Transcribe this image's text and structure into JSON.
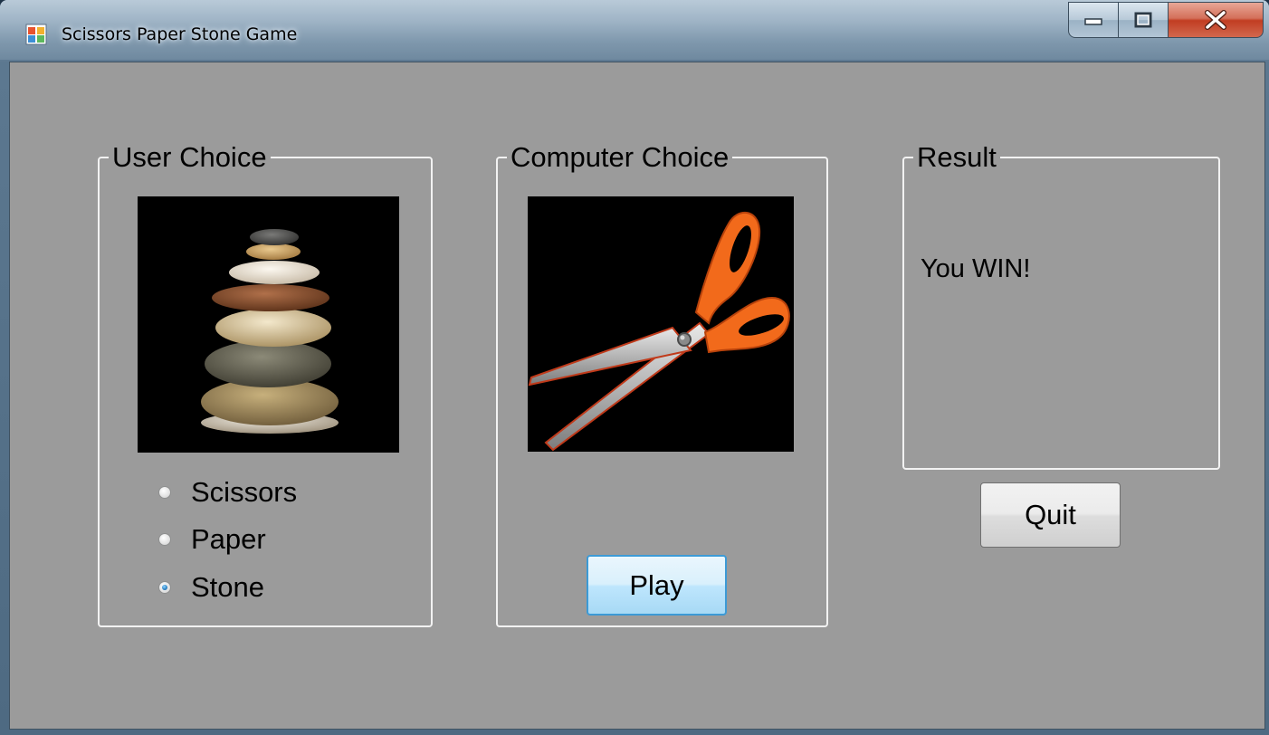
{
  "window": {
    "title": "Scissors Paper Stone Game",
    "icon": "app-window-icon",
    "controls": [
      "minimize-icon",
      "maximize-icon",
      "close-icon"
    ]
  },
  "user_choice": {
    "legend": "User Choice",
    "image": "stone-stack-image",
    "options": [
      {
        "label": "Scissors",
        "checked": false
      },
      {
        "label": "Paper",
        "checked": false
      },
      {
        "label": "Stone",
        "checked": true
      }
    ]
  },
  "computer_choice": {
    "legend": "Computer Choice",
    "image": "scissors-image",
    "play_label": "Play"
  },
  "result": {
    "legend": "Result",
    "text": "You WIN!"
  },
  "quit_label": "Quit",
  "colors": {
    "client_bg": "#9b9b9b",
    "group_border": "#f2f2f2",
    "scissor_handle": "#f26a1b",
    "close_button": "#c13d22",
    "radio_accent": "#2a7fc1"
  }
}
